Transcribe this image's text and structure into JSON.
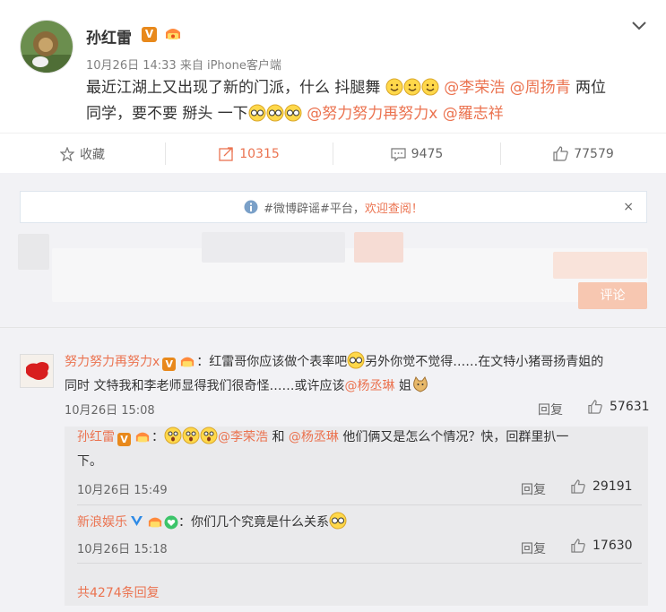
{
  "post": {
    "author": "孙红雷",
    "time": "10月26日 14:33",
    "source_prefix": "来自",
    "source": "iPhone客户端",
    "text_1": "最近江湖上又出现了新的门派，什么 抖腿舞",
    "mention_1": "@李荣浩",
    "mention_2": "@周扬青",
    "text_2": " 两位",
    "text_3": "同学，要不要 掰头 一下",
    "mention_3": "@努力努力再努力x",
    "mention_4": "@羅志祥"
  },
  "actions": {
    "favorite_label": "收藏",
    "repost_count": "10315",
    "comment_count": "9475",
    "like_count": "77579"
  },
  "notice": {
    "text_1": "#微博辟谣#平台，",
    "text_2": "欢迎查阅！",
    "close": "×"
  },
  "composer": {
    "submit_label": "评论"
  },
  "comment": {
    "author": "努力努力再努力x",
    "sep": "：",
    "text_1": "红雷哥你应该做个表率吧",
    "text_2": "另外你觉不觉得……在文特小猪哥扬青姐的",
    "text_3": "同时 文特我和李老师显得我们很奇怪……或许应该",
    "mention": "@杨丞琳",
    "text_4": " 姐",
    "time": "10月26日 15:08",
    "reply_label": "回复",
    "likes": "57631"
  },
  "replies": [
    {
      "author": "孙红雷",
      "sep": "：",
      "mention_1": "@李荣浩",
      "mid": " 和 ",
      "mention_2": "@杨丞琳",
      "text_1": " 他们俩又是怎么个情况？快，回群里扒一",
      "text_2": "下。",
      "time": "10月26日 15:49",
      "reply_label": "回复",
      "likes": "29191"
    },
    {
      "author": "新浪娱乐",
      "sep": "：",
      "text_1": "你们几个究竟是什么关系",
      "time": "10月26日 15:18",
      "reply_label": "回复",
      "likes": "17630"
    }
  ],
  "more_replies": "共4274条回复",
  "colors": {
    "accent": "#eb7350",
    "panel_bg": "#f2f2f5",
    "reply_bg": "#eaeaec",
    "vip_orange": "#e8891c"
  }
}
